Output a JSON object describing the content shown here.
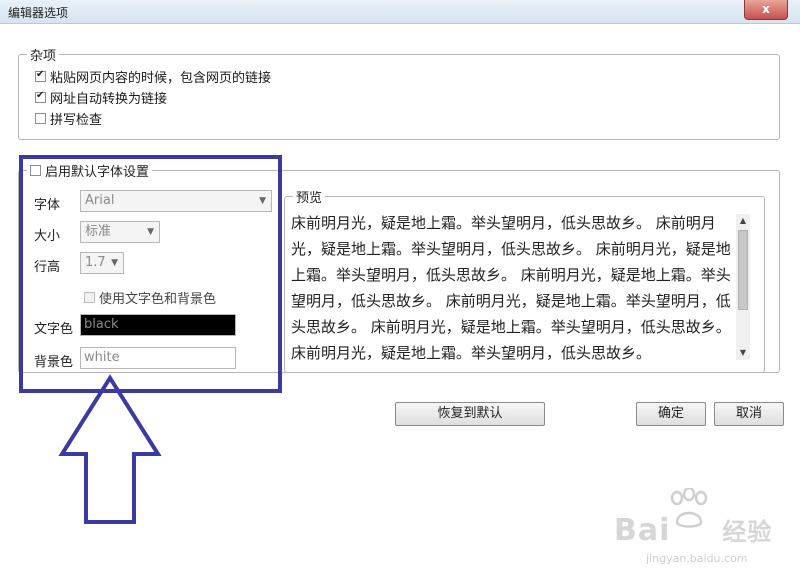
{
  "window": {
    "title": "编辑器选项",
    "close_label": "x"
  },
  "misc": {
    "legend": "杂项",
    "options": [
      {
        "label": "粘贴网页内容的时候，包含网页的链接",
        "checked": true
      },
      {
        "label": "网址自动转换为链接",
        "checked": true
      },
      {
        "label": "拼写检查",
        "checked": false
      }
    ]
  },
  "font_settings": {
    "enable_label": "启用默认字体设置",
    "enabled": false,
    "font_label": "字体",
    "font_value": "Arial",
    "size_label": "大小",
    "size_value": "标准",
    "line_height_label": "行高",
    "line_height_value": "1.7",
    "use_colors_label": "使用文字色和背景色",
    "text_color_label": "文字色",
    "text_color_value": "black",
    "bg_color_label": "背景色",
    "bg_color_value": "white"
  },
  "preview": {
    "legend": "预览",
    "text": "床前明月光，疑是地上霜。举头望明月，低头思故乡。 床前明月光，疑是地上霜。举头望明月，低头思故乡。 床前明月光，疑是地上霜。举头望明月，低头思故乡。 床前明月光，疑是地上霜。举头望明月，低头思故乡。 床前明月光，疑是地上霜。举头望明月，低头思故乡。 床前明月光，疑是地上霜。举头望明月，低头思故乡。 床前明月光，疑是地上霜。举头望明月，低头思故乡。"
  },
  "buttons": {
    "restore_default": "恢复到默认",
    "ok": "确定",
    "cancel": "取消"
  },
  "watermark": {
    "brand": "Bai",
    "brand_suffix": "经验",
    "url": "jingyan.baidu.com"
  },
  "colors": {
    "annotation": "#3b3aa3",
    "text_swatch_bg": "#000000",
    "bg_swatch_bg": "#ffffff"
  }
}
